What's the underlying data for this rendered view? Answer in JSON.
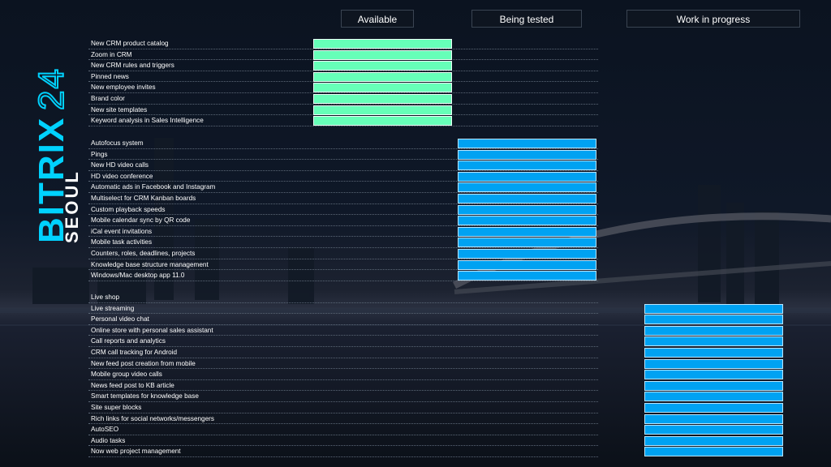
{
  "brand": {
    "name": "BITRIX24",
    "subtitle": "SEOUL"
  },
  "columns": [
    {
      "label": "Available",
      "color": "#66ffb8"
    },
    {
      "label": "Being tested",
      "color": "#00a2f2"
    },
    {
      "label": "Work in progress",
      "color": "#00a2f2"
    }
  ],
  "groups": [
    {
      "status": "Available",
      "items": [
        "New CRM product catalog",
        "Zoom in CRM",
        "New CRM rules and triggers",
        "Pinned news",
        "New employee invites",
        "Brand color",
        "New site templates",
        "Keyword analysis in Sales Intelligence"
      ]
    },
    {
      "status": "Being tested",
      "items": [
        "Autofocus system",
        "Pings",
        "New HD video calls",
        "HD video conference",
        "Automatic ads in Facebook and Instagram",
        "Multiselect for CRM Kanban boards",
        "Custom playback speeds",
        "Mobile calendar sync by QR code",
        "iCal event invitations",
        "Mobile task activities",
        "Counters, roles, deadlines, projects",
        "Knowledge base structure management",
        "Windows/Mac  desktop app 11.0"
      ]
    },
    {
      "status": "Work in progress",
      "items": [
        "Live shop",
        "Live streaming",
        "Personal video chat",
        "Online store with personal sales assistant",
        "Call reports and analytics",
        "CRM call tracking for Android",
        "New feed post creation from mobile",
        "Mobile group video calls",
        "News feed post to KB article",
        "Smart templates for knowledge base",
        "Site super blocks",
        "Rich links for social networks/messengers",
        "AutoSEO",
        "Audio tasks",
        "Now web  project management"
      ]
    }
  ]
}
